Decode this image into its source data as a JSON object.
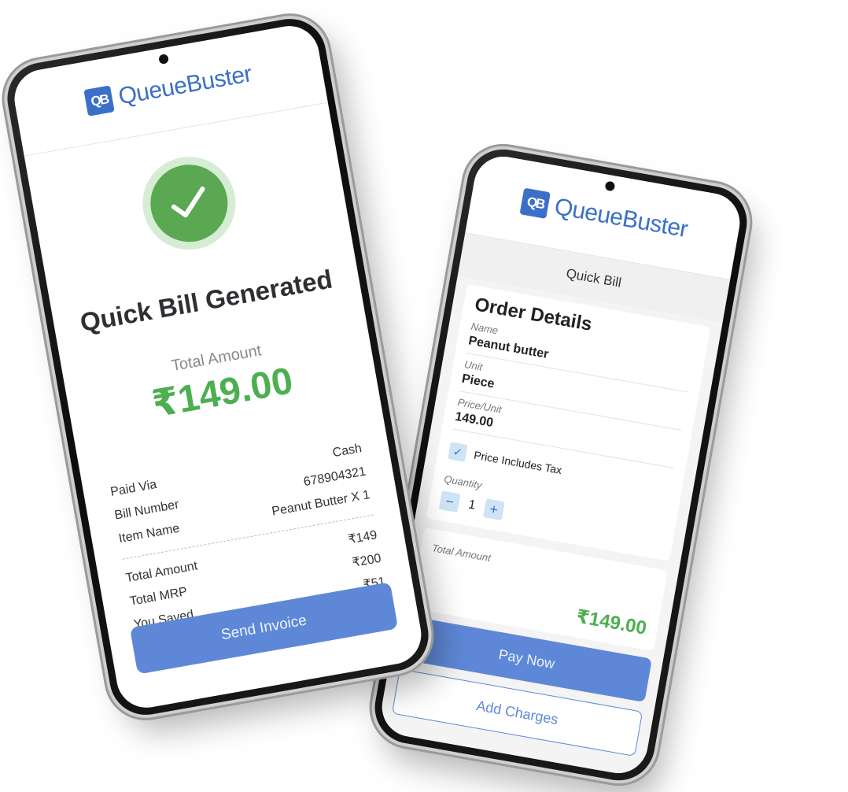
{
  "brand": {
    "logo_mark": "QB",
    "logo_text": "QueueBuster",
    "accent": "#3b6fc9",
    "success": "#4caf50"
  },
  "left_phone": {
    "icon": "check-icon",
    "title": "Quick Bill Generated",
    "total_label": "Total Amount",
    "total_value": "₹149.00",
    "details": [
      {
        "label": "Paid Via",
        "value": "Cash"
      },
      {
        "label": "Bill Number",
        "value": "678904321"
      },
      {
        "label": "Item Name",
        "value": "Peanut Butter X 1"
      }
    ],
    "summary": [
      {
        "label": "Total Amount",
        "value": "₹149"
      },
      {
        "label": "Total MRP",
        "value": "₹200"
      },
      {
        "label": "You Saved",
        "value": "₹51"
      }
    ],
    "send_button": "Send Invoice"
  },
  "right_phone": {
    "subbar_title": "Quick Bill",
    "section_title": "Order Details",
    "fields": {
      "name_label": "Name",
      "name_value": "Peanut butter",
      "unit_label": "Unit",
      "unit_value": "Piece",
      "price_label": "Price/Unit",
      "price_value": "149.00"
    },
    "tax_checkbox_label": "Price Includes Tax",
    "tax_checked": true,
    "quantity_label": "Quantity",
    "quantity_value": "1",
    "minus": "−",
    "plus": "+",
    "total_label": "Total Amount",
    "total_value": "₹149.00",
    "pay_button": "Pay Now",
    "charges_button": "Add Charges"
  }
}
